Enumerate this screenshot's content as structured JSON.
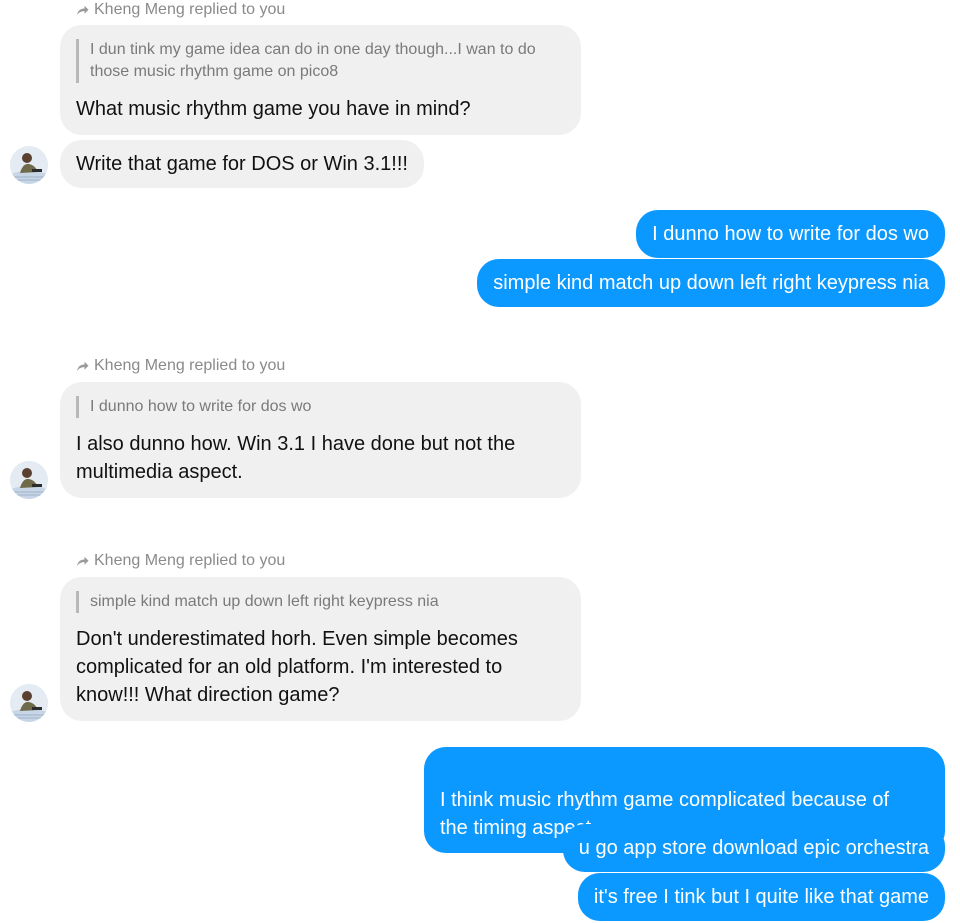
{
  "conversation": {
    "messages": [
      {
        "reply_header": "Kheng Meng replied to you",
        "quote": "I dun tink my game idea can do in one day though...I wan to do those music rhythm game on pico8",
        "text": "What music rhythm game you have in mind?"
      },
      {
        "text": "Write that game for DOS or Win 3.1!!!"
      },
      {
        "text": "I dunno how to write for dos wo"
      },
      {
        "text": "simple kind match up down left right keypress nia"
      },
      {
        "reply_header": "Kheng Meng replied to you",
        "quote": "I dunno how to write for dos wo",
        "text": "I also dunno how. Win 3.1 I have done but not the\nmultimedia aspect."
      },
      {
        "reply_header": "Kheng Meng replied to you",
        "quote": "simple kind match up down left right keypress nia",
        "text": "Don't underestimated horh. Even simple becomes\ncomplicated for an old platform. I'm interested to\nknow!!! What direction game?"
      },
      {
        "text": "I think music rhythm game complicated because of\nthe timing aspect"
      },
      {
        "text": "u go app store download epic orchestra"
      },
      {
        "text": "it's free I tink but I quite like that game"
      }
    ]
  },
  "colors": {
    "outgoing_bubble": "#0b99ff",
    "incoming_bubble": "#f0f0f0",
    "meta_text": "#8a8a8a"
  },
  "icons": {
    "reply": "reply-arrow-icon",
    "avatar": "user-avatar"
  }
}
